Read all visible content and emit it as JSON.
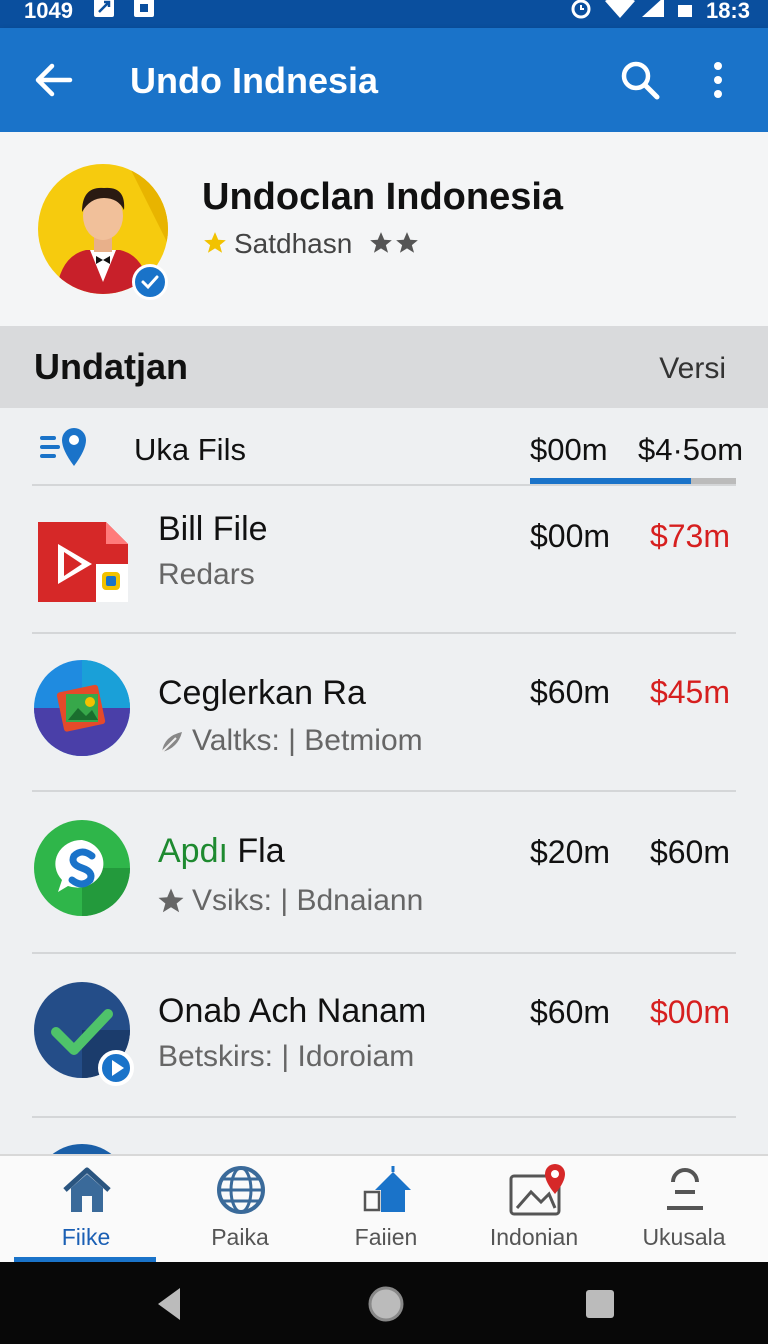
{
  "status": {
    "time_left": "1049",
    "time_right": "18:3"
  },
  "appbar": {
    "title": "Undo Indnesia",
    "icons": [
      "back-arrow-icon",
      "search-icon",
      "more-vert-icon"
    ],
    "color": "#1a73c9"
  },
  "profile": {
    "name": "Undoclan Indonesia",
    "subtitle": "Satdhasn",
    "verified": true
  },
  "section": {
    "title": "Undatjan",
    "right_label": "Versi"
  },
  "filter": {
    "label": "Uka Fils",
    "value1": "$00m",
    "value2": "$4·5om",
    "progress": 0.78
  },
  "items": [
    {
      "name": "Bill File",
      "subtitle": "Redars",
      "value1": "$00m",
      "value2": "$73m",
      "value2_color": "#d61f1f",
      "icon": "video-file-icon"
    },
    {
      "name": "Ceglerkan Ra",
      "subtitle": "Valtks: | Betmiom",
      "value1": "$60m",
      "value2": "$45m",
      "value2_color": "#d61f1f",
      "icon": "gallery-app-icon"
    },
    {
      "name_green": "Apdı",
      "name_rest": " Fla",
      "subtitle": "Vsiks: | Bdnaiann",
      "value1": "$20m",
      "value2": "$60m",
      "value2_color": "#111111",
      "icon": "chat-s-icon"
    },
    {
      "name": "Onab Ach Nanam",
      "subtitle": "Betskirs: | Idoroiam",
      "value1": "$60m",
      "value2": "$00m",
      "value2_color": "#d61f1f",
      "icon": "checkmark-app-icon"
    }
  ],
  "bottomnav": [
    {
      "label": "Fiike",
      "icon": "home-icon",
      "active": true
    },
    {
      "label": "Paika",
      "icon": "globe-icon",
      "active": false
    },
    {
      "label": "Faiien",
      "icon": "upload-home-icon",
      "active": false
    },
    {
      "label": "Indonian",
      "icon": "image-pin-icon",
      "active": false
    },
    {
      "label": "Ukusala",
      "icon": "person-icon",
      "active": false
    }
  ]
}
